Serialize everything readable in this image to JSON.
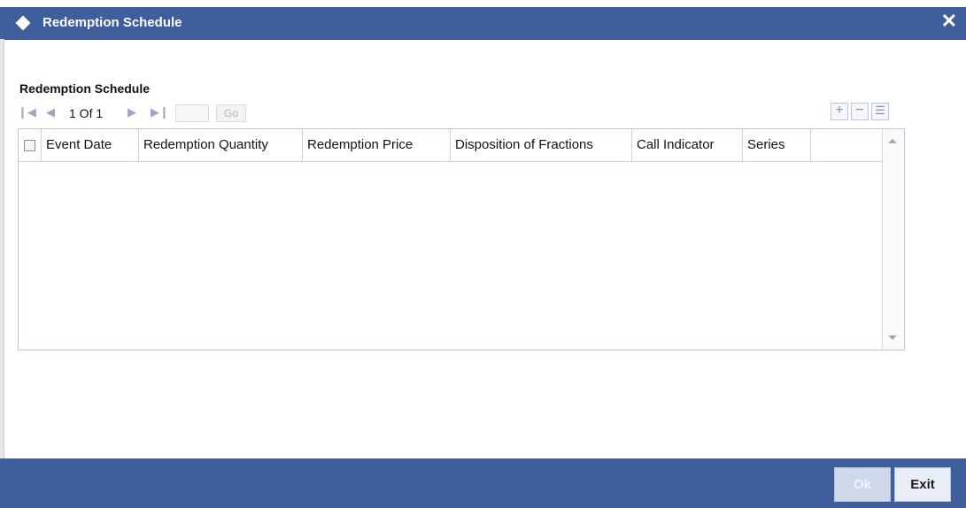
{
  "window": {
    "title": "Redemption Schedule",
    "close_label": "✕"
  },
  "section": {
    "title": "Redemption Schedule"
  },
  "pagination": {
    "page_info": "1 Of 1",
    "go_label": "Go",
    "page_input_value": ""
  },
  "toolbar": {
    "add_label": "+",
    "delete_label": "−",
    "view_label": "☰"
  },
  "grid": {
    "columns": [
      "Event Date",
      "Redemption Quantity",
      "Redemption Price",
      "Disposition of Fractions",
      "Call Indicator",
      "Series"
    ],
    "rows": []
  },
  "footer": {
    "ok_label": "Ok",
    "exit_label": "Exit"
  },
  "colors": {
    "header_blue": "#3e5f9c",
    "footer_blue": "#3e5f9c"
  },
  "icons": {
    "title": "diamond-icon",
    "close": "close-icon",
    "first": "first-page-icon",
    "prev": "prev-page-icon",
    "next": "next-page-icon",
    "last": "last-page-icon"
  }
}
